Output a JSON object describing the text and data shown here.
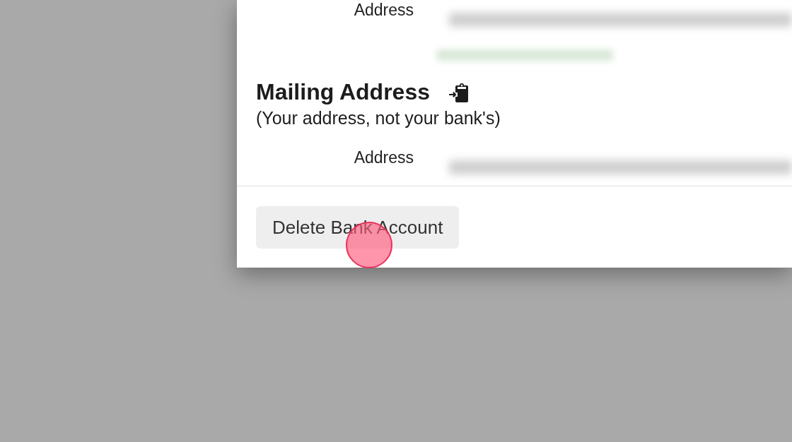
{
  "sections": [
    {
      "fields": [
        {
          "label": "Address",
          "hint": true
        }
      ]
    },
    {
      "title": "Mailing Address",
      "subtitle": "(Your address, not your bank's)",
      "fields": [
        {
          "label": "Address",
          "hint": false
        }
      ]
    }
  ],
  "footer": {
    "button": "Delete Bank Account"
  }
}
